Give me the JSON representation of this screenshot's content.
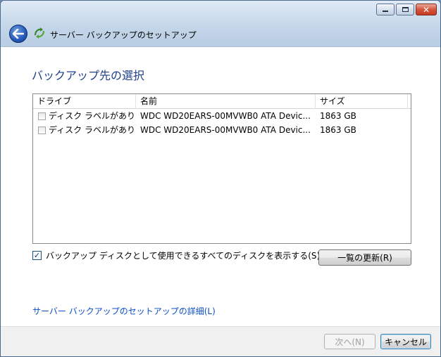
{
  "window": {
    "title": "サーバー バックアップのセットアップ"
  },
  "page": {
    "heading": "バックアップ先の選択"
  },
  "disk_list": {
    "columns": [
      "ドライブ",
      "名前",
      "サイズ"
    ],
    "rows": [
      {
        "drive": "ディスク ラベルがありま...",
        "name": "WDC WD20EARS-00MVWB0 ATA Devic...",
        "size": "1863 GB",
        "checked": false
      },
      {
        "drive": "ディスク ラベルがありま...",
        "name": "WDC WD20EARS-00MVWB0 ATA Devic...",
        "size": "1863 GB",
        "checked": false
      }
    ]
  },
  "show_all": {
    "label": "バックアップ ディスクとして使用できるすべてのディスクを表示する(S)",
    "checked": true
  },
  "refresh_button": "一覧の更新(R)",
  "details_link": "サーバー バックアップのセットアップの詳細(L)",
  "footer": {
    "next_label": "次へ(N)",
    "cancel_label": "キャンセル"
  }
}
